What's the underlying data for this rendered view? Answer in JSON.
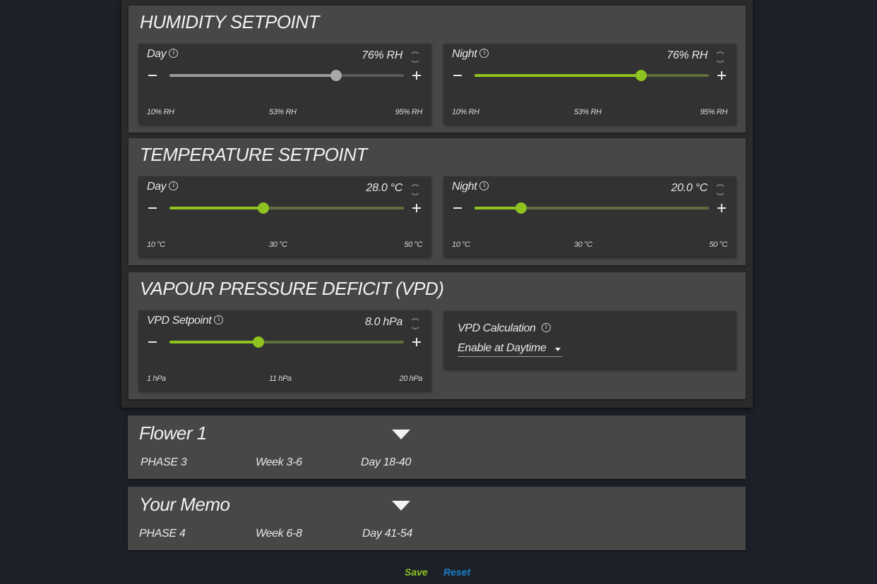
{
  "humidity": {
    "title": "HUMIDITY SETPOINT",
    "day": {
      "label": "Day",
      "value": "76% RH",
      "min": "10% RH",
      "mid": "53% RH",
      "max": "95% RH",
      "level_pct": 71
    },
    "night": {
      "label": "Night",
      "value": "76% RH",
      "min": "10% RH",
      "mid": "53% RH",
      "max": "95% RH",
      "level_pct": 71
    }
  },
  "temperature": {
    "title": "TEMPERATURE SETPOINT",
    "day": {
      "label": "Day",
      "value": "28.0 °C",
      "min": "10 °C",
      "mid": "30 °C",
      "max": "50 °C",
      "level_pct": 40
    },
    "night": {
      "label": "Night",
      "value": "20.0 °C",
      "min": "10 °C",
      "mid": "30 °C",
      "max": "50 °C",
      "level_pct": 20
    }
  },
  "vpd": {
    "title": "VAPOUR PRESSURE DEFICIT (VPD)",
    "setpoint": {
      "label": "VPD Setpoint",
      "value": "8.0 hPa",
      "min": "1 hPa",
      "mid": "11 hPa",
      "max": "20 hPa",
      "level_pct": 38
    },
    "calc_label": "VPD Calculation",
    "calc_value": "Enable at Daytime"
  },
  "phases": [
    {
      "title": "Flower 1",
      "phase": "PHASE 3",
      "week": "Week  3-6",
      "day": "Day  18-40"
    },
    {
      "title": "Your Memo",
      "phase": "PHASE 4",
      "week": "Week  6-8",
      "day": "Day  41-54"
    }
  ],
  "footer": {
    "save": "Save",
    "reset": "Reset"
  },
  "colors": {
    "accent": "#8fc31f",
    "save": "#8fc31f",
    "reset": "#1a7fc9",
    "background": "#1c2129"
  },
  "icons": {
    "info": "info-icon",
    "reset": "refresh-icon",
    "collapse": "triangle-down-icon"
  }
}
